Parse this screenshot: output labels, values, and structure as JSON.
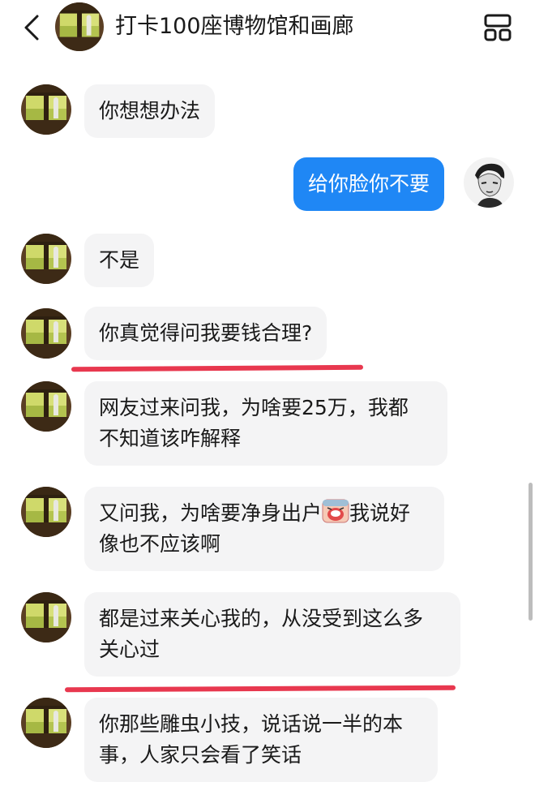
{
  "header": {
    "title": "打卡100座博物馆和画廊"
  },
  "messages": [
    {
      "sender": "other",
      "text": "你想想办法"
    },
    {
      "sender": "me",
      "text": "给你脸你不要"
    },
    {
      "sender": "other",
      "text": "不是"
    },
    {
      "sender": "other",
      "text": "你真觉得问我要钱合理?"
    },
    {
      "sender": "other",
      "text": "网友过来问我，为啥要25万，我都\n不知道该咋解释"
    },
    {
      "sender": "other",
      "text_before": "又问我，为啥要净身出户",
      "emoji": "crying-face-emoji",
      "text_after": "我说好\n像也不应该啊"
    },
    {
      "sender": "other",
      "text": "都是过来关心我的，从没受到这么多\n关心过"
    },
    {
      "sender": "other",
      "text": "你那些雕虫小技，说话说一半的本\n事，人家只会看了笑话"
    }
  ],
  "colors": {
    "my_bubble": "#1f87f5",
    "other_bubble": "#f4f4f5",
    "highlight_underline": "#e8384f"
  },
  "icons": {
    "back": "chevron-left-icon",
    "menu": "grid-menu-icon"
  }
}
